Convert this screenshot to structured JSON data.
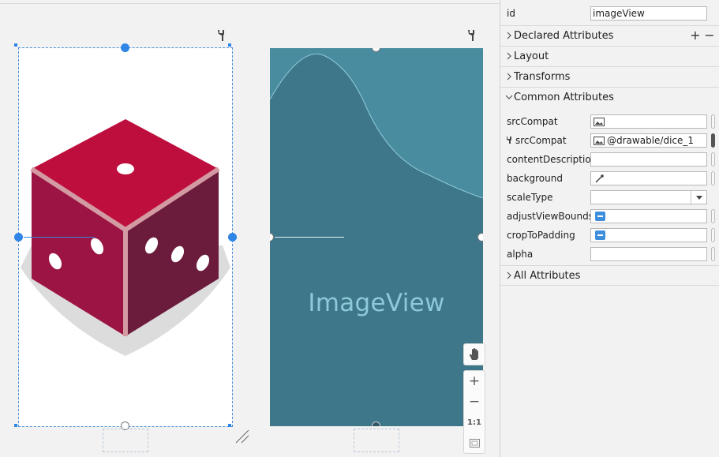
{
  "blueprint": {
    "label": "ImageView"
  },
  "zoom": {
    "pan_icon": "hand-icon",
    "zoom_in": "+",
    "zoom_out": "−",
    "actual_size": "1:1",
    "fit_icon": "fit-screen-icon"
  },
  "panel": {
    "id_label": "id",
    "id_value": "imageView",
    "sections": {
      "declared": "Declared Attributes",
      "layout": "Layout",
      "transforms": "Transforms",
      "common": "Common Attributes",
      "all": "All Attributes"
    },
    "declared_actions": {
      "add": "+",
      "remove": "−"
    },
    "attributes": [
      {
        "name": "srcCompat",
        "value": ""
      },
      {
        "name": "srcCompat",
        "value": "@drawable/dice_1"
      },
      {
        "name": "contentDescription",
        "value": ""
      },
      {
        "name": "background",
        "value": ""
      },
      {
        "name": "scaleType",
        "value": ""
      },
      {
        "name": "adjustViewBounds",
        "value": ""
      },
      {
        "name": "cropToPadding",
        "value": ""
      },
      {
        "name": "alpha",
        "value": ""
      }
    ]
  },
  "colors": {
    "dice_top": "#be0e3e",
    "dice_left": "#9c1443",
    "dice_right": "#6b1c3c",
    "dice_edge": "#d39aa3",
    "blueprint_bg": "#3d7789",
    "accent": "#2f86e6"
  }
}
